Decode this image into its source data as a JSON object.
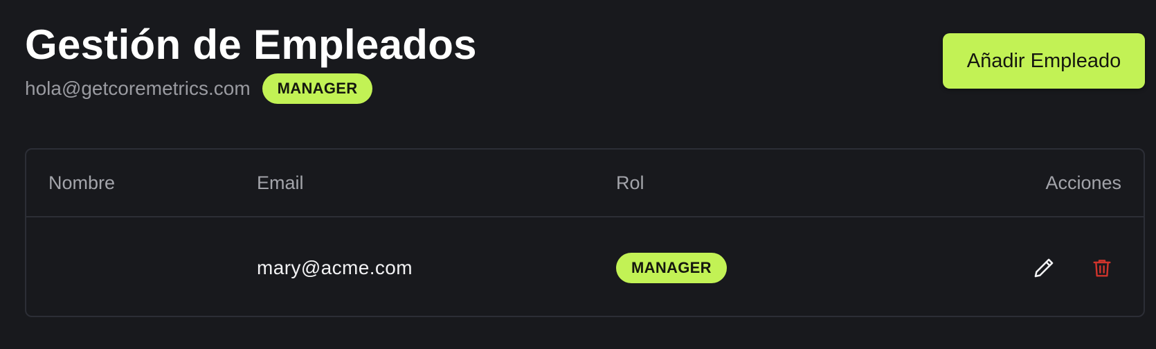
{
  "header": {
    "title": "Gestión de Empleados",
    "user_email": "hola@getcoremetrics.com",
    "user_role": "MANAGER",
    "add_button_label": "Añadir Empleado"
  },
  "table": {
    "columns": [
      "Nombre",
      "Email",
      "Rol",
      "Acciones"
    ],
    "rows": [
      {
        "name": "",
        "email": "mary@acme.com",
        "role": "MANAGER",
        "actions": [
          "pencil-icon",
          "trash-icon"
        ]
      }
    ]
  },
  "colors": {
    "background": "#18191d",
    "accent": "#c2f255",
    "delete": "#d0342c",
    "border": "#2c2e36"
  }
}
